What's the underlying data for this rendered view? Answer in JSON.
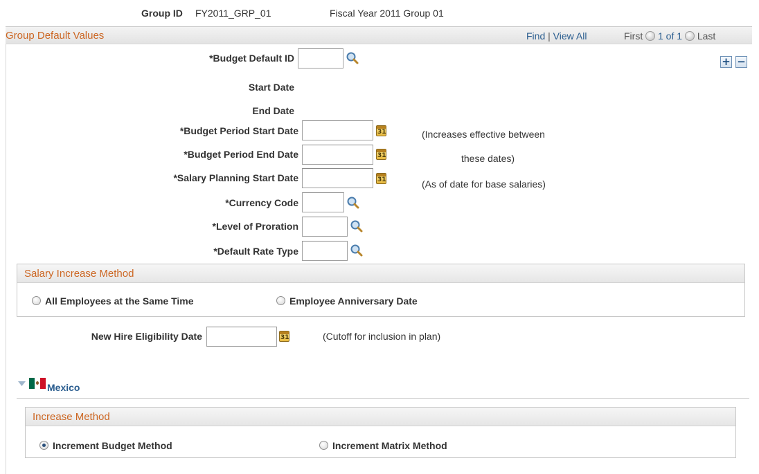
{
  "header": {
    "group_id_label": "Group ID",
    "group_id_value": "FY2011_GRP_01",
    "group_description": "Fiscal Year 2011 Group 01"
  },
  "group_default_values": {
    "title": "Group Default Values",
    "find": "Find",
    "separator": "|",
    "view_all": "View All",
    "first": "First",
    "range": "1 of 1",
    "last": "Last",
    "add_symbol": "+",
    "remove_symbol": "−"
  },
  "fields": {
    "budget_default_id": {
      "label": "*Budget Default ID",
      "value": ""
    },
    "start_date": {
      "label": "Start Date"
    },
    "end_date": {
      "label": "End Date"
    },
    "budget_period_start": {
      "label": "*Budget Period Start Date",
      "value": ""
    },
    "budget_period_end": {
      "label": "*Budget Period End Date",
      "value": ""
    },
    "salary_planning_start": {
      "label": "*Salary Planning Start Date",
      "value": ""
    },
    "currency_code": {
      "label": "*Currency Code",
      "value": ""
    },
    "level_of_proration": {
      "label": "*Level of Proration",
      "value": ""
    },
    "default_rate_type": {
      "label": "*Default Rate Type",
      "value": ""
    },
    "new_hire_eligibility": {
      "label": "New Hire Eligibility Date",
      "value": ""
    }
  },
  "notes": {
    "increases_line1": "(Increases effective between",
    "increases_line2": "these dates)",
    "as_of_date": "(As of date for base salaries)",
    "cutoff": "(Cutoff for inclusion in plan)"
  },
  "salary_increase_method": {
    "title": "Salary Increase Method",
    "options": [
      {
        "label": "All Employees at the Same Time",
        "checked": false
      },
      {
        "label": "Employee Anniversary Date",
        "checked": false
      }
    ]
  },
  "country_section": {
    "name": "Mexico",
    "collapse_icon": "triangle-down-icon",
    "flag_icon": "mexico-flag-icon",
    "flag_colors": [
      "#006847",
      "#ffffff",
      "#ce1126"
    ]
  },
  "increase_method": {
    "title": "Increase Method",
    "options": [
      {
        "label": "Increment Budget Method",
        "checked": true
      },
      {
        "label": "Increment Matrix Method",
        "checked": false
      }
    ]
  },
  "colors": {
    "section_title": "#cc6622",
    "link": "#2a5d8f"
  }
}
